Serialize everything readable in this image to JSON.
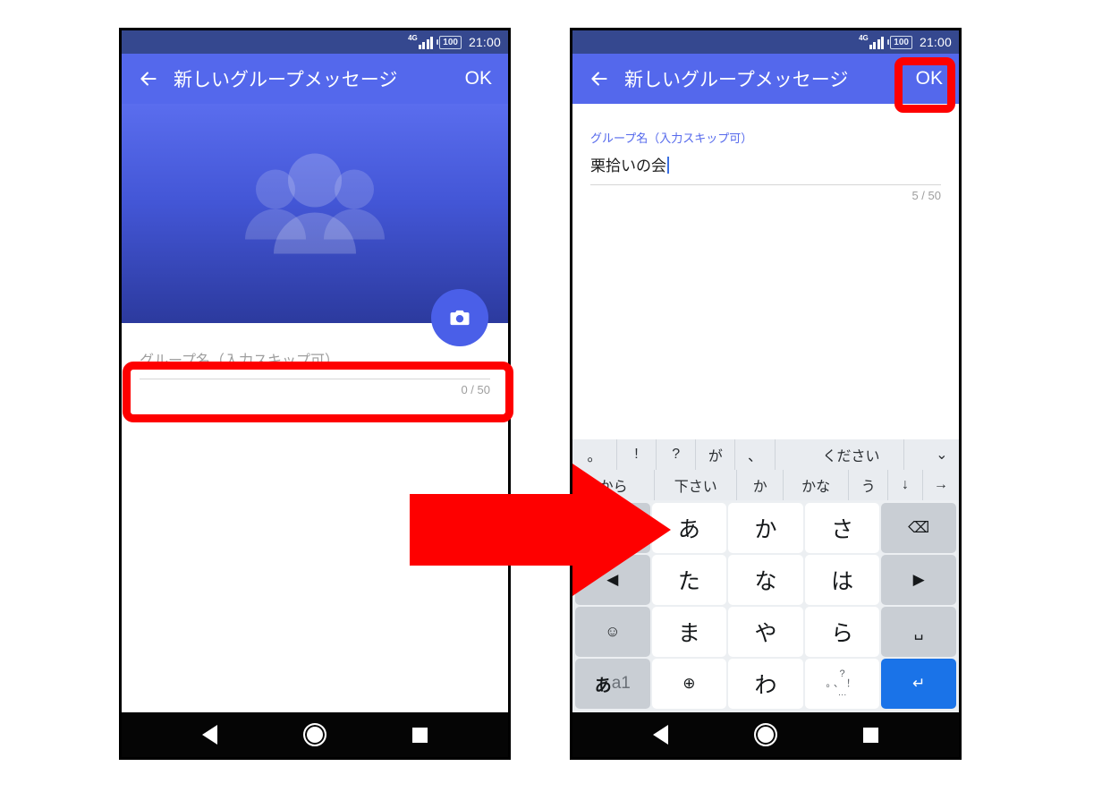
{
  "status_bar": {
    "network": "4G",
    "battery": "100",
    "time": "21:00"
  },
  "app_bar": {
    "back_icon": "back-arrow-icon",
    "title": "新しいグループメッセージ",
    "ok_label": "OK"
  },
  "left_screen": {
    "hero": {
      "group_icon": "group-people-icon",
      "camera_fab_icon": "camera-icon"
    },
    "group_name_field": {
      "placeholder": "グループ名（入力スキップ可）",
      "value": "",
      "counter": "0 / 50"
    }
  },
  "right_screen": {
    "group_name_field": {
      "label": "グループ名（入力スキップ可）",
      "value": "栗拾いの会",
      "counter": "5 / 50"
    },
    "keyboard": {
      "suggestions_row1": [
        "。",
        "!",
        "?",
        "が",
        "、",
        "",
        "ください",
        "",
        "⌄"
      ],
      "suggestions_row2": [
        "から",
        "下さい",
        "か",
        "かな",
        "う",
        "↓",
        "→"
      ],
      "keys": [
        {
          "label": "↰",
          "name": "undo-key",
          "style": "gray",
          "size": "small"
        },
        {
          "label": "あ",
          "name": "key-a",
          "style": "white"
        },
        {
          "label": "か",
          "name": "key-ka",
          "style": "white"
        },
        {
          "label": "さ",
          "name": "key-sa",
          "style": "white"
        },
        {
          "label": "⌫",
          "name": "backspace-key",
          "style": "gray",
          "size": "small"
        },
        {
          "label": "◀",
          "name": "cursor-left-key",
          "style": "gray",
          "size": "small"
        },
        {
          "label": "た",
          "name": "key-ta",
          "style": "white"
        },
        {
          "label": "な",
          "name": "key-na",
          "style": "white"
        },
        {
          "label": "は",
          "name": "key-ha",
          "style": "white"
        },
        {
          "label": "▶",
          "name": "cursor-right-key",
          "style": "gray",
          "size": "small"
        },
        {
          "label": "☺",
          "name": "emoji-key",
          "style": "gray",
          "size": "small"
        },
        {
          "label": "ま",
          "name": "key-ma",
          "style": "white"
        },
        {
          "label": "や",
          "name": "key-ya",
          "style": "white"
        },
        {
          "label": "ら",
          "name": "key-ra",
          "style": "white"
        },
        {
          "label": "␣",
          "name": "space-key",
          "style": "gray",
          "size": "small"
        },
        {
          "label": "あa1",
          "name": "input-mode-key",
          "style": "gray",
          "size": "aa1"
        },
        {
          "label": "⊕",
          "name": "globe-key",
          "style": "white",
          "size": "small"
        },
        {
          "label": "わ",
          "name": "key-wa",
          "style": "white"
        },
        {
          "label": "punct",
          "name": "punctuation-key",
          "style": "white",
          "size": "punct"
        },
        {
          "label": "↵",
          "name": "enter-key",
          "style": "blue",
          "size": "small"
        }
      ],
      "punctuation_key": {
        "top": "?",
        "mid": "。、！",
        "bottom": "…"
      }
    }
  },
  "nav_bar": {
    "back_icon": "nav-back-icon",
    "home_icon": "nav-home-icon",
    "recents_icon": "nav-recents-icon"
  },
  "annotations": {
    "highlight_color": "#fe0000",
    "field_highlight": "group-name-field-highlight",
    "ok_highlight": "ok-button-highlight",
    "flow_arrow": "right-pointing-flow-arrow"
  }
}
